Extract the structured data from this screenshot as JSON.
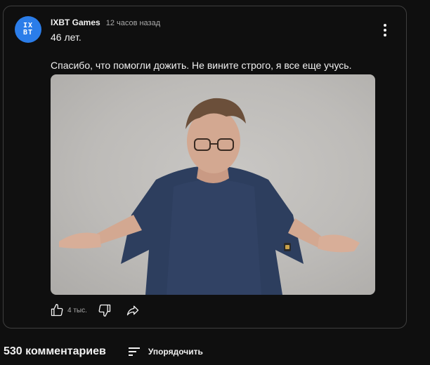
{
  "post": {
    "channel_name": "IXBT Games",
    "avatar_text_top": "IX",
    "avatar_text_bottom": "BT",
    "time": "12 часов назад",
    "line1": "46 лет.",
    "line2": "Спасибо, что помогли дожить. Не вините строго, я все еще учусь.",
    "accent_color": "#2b7de9"
  },
  "actions": {
    "likes": "4 тыс.",
    "icons": [
      "thumbs-up-icon",
      "thumbs-down-icon",
      "share-icon",
      "more-vertical-icon"
    ]
  },
  "comments": {
    "count_label": "530 комментариев",
    "sort_label": "Упорядочить"
  }
}
